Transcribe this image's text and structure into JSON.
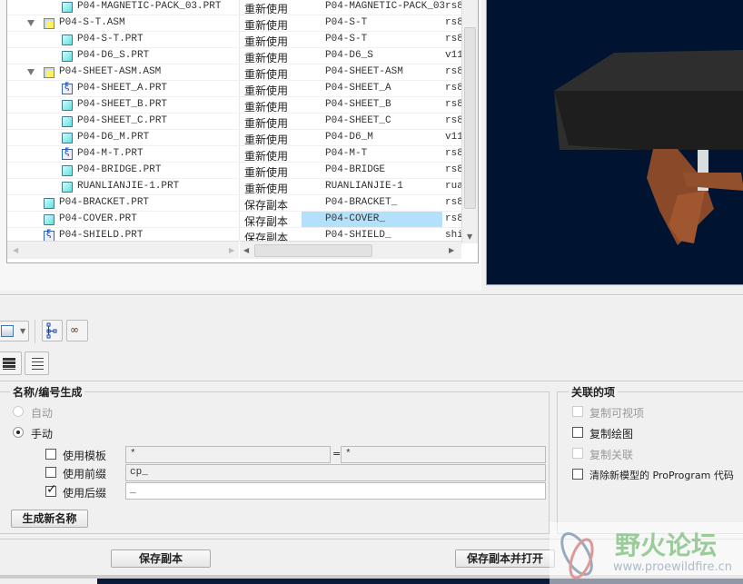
{
  "tree": {
    "rows": [
      {
        "name": "P04-MAGNETIC-PACK_03.PRT",
        "action": "重新使用",
        "new_name": "P04-MAGNETIC-PACK_03",
        "extra": "rs8",
        "level": 2,
        "type": "part"
      },
      {
        "name": "P04-S-T.ASM",
        "action": "重新使用",
        "new_name": "P04-S-T",
        "extra": "rs8",
        "level": 1,
        "type": "asm"
      },
      {
        "name": "P04-S-T.PRT",
        "action": "重新使用",
        "new_name": "P04-S-T",
        "extra": "rs8",
        "level": 2,
        "type": "part"
      },
      {
        "name": "P04-D6_S.PRT",
        "action": "重新使用",
        "new_name": "P04-D6_S",
        "extra": "v11",
        "level": 2,
        "type": "part"
      },
      {
        "name": "P04-SHEET-ASM.ASM",
        "action": "重新使用",
        "new_name": "P04-SHEET-ASM",
        "extra": "rs8",
        "level": 1,
        "type": "asm"
      },
      {
        "name": "P04-SHEET_A.PRT",
        "action": "重新使用",
        "new_name": "P04-SHEET_A",
        "extra": "rs8",
        "level": 2,
        "type": "sheet"
      },
      {
        "name": "P04-SHEET_B.PRT",
        "action": "重新使用",
        "new_name": "P04-SHEET_B",
        "extra": "rs8",
        "level": 2,
        "type": "part"
      },
      {
        "name": "P04-SHEET_C.PRT",
        "action": "重新使用",
        "new_name": "P04-SHEET_C",
        "extra": "rs8",
        "level": 2,
        "type": "part"
      },
      {
        "name": "P04-D6_M.PRT",
        "action": "重新使用",
        "new_name": "P04-D6_M",
        "extra": "v11",
        "level": 2,
        "type": "part"
      },
      {
        "name": "P04-M-T.PRT",
        "action": "重新使用",
        "new_name": "P04-M-T",
        "extra": "rs8",
        "level": 2,
        "type": "sheet"
      },
      {
        "name": "P04-BRIDGE.PRT",
        "action": "重新使用",
        "new_name": "P04-BRIDGE",
        "extra": "rs8",
        "level": 2,
        "type": "part"
      },
      {
        "name": "RUANLIANJIE-1.PRT",
        "action": "重新使用",
        "new_name": "RUANLIANJIE-1",
        "extra": "rua",
        "level": 2,
        "type": "part"
      },
      {
        "name": "P04-BRACKET.PRT",
        "action": "保存副本",
        "new_name": "P04-BRACKET_",
        "extra": "rs8",
        "level": 1,
        "type": "part"
      },
      {
        "name": "P04-COVER.PRT",
        "action": "保存副本",
        "new_name": "P04-COVER_",
        "extra": "rs8",
        "level": 1,
        "type": "part",
        "selected": true
      },
      {
        "name": "P04-SHIELD.PRT",
        "action": "保存副本",
        "new_name": "P04-SHIELD_",
        "extra": "shi",
        "level": 1,
        "type": "sheet"
      }
    ]
  },
  "naming": {
    "title": "名称/编号生成",
    "auto": "自动",
    "manual": "手动",
    "use_template": "使用模板",
    "template_from": "*",
    "equals": "=",
    "template_to": "*",
    "use_prefix": "使用前缀",
    "prefix_value": "cp_",
    "use_suffix": "使用后缀",
    "suffix_value": "_",
    "generate_button": "生成新名称"
  },
  "related": {
    "title": "关联的项",
    "copy_visible": "复制可视项",
    "copy_drawing": "复制绘图",
    "copy_relations": "复制关联",
    "clear_proprogram": "清除新模型的 ProProgram 代码"
  },
  "buttons": {
    "save_copy": "保存副本",
    "save_copy_open": "保存副本并打开"
  },
  "watermark": {
    "title": "野火论坛",
    "url": "www.proewildfire.cn"
  },
  "colors": {
    "viewport": "#001330",
    "selection": "#b3e0fa"
  }
}
